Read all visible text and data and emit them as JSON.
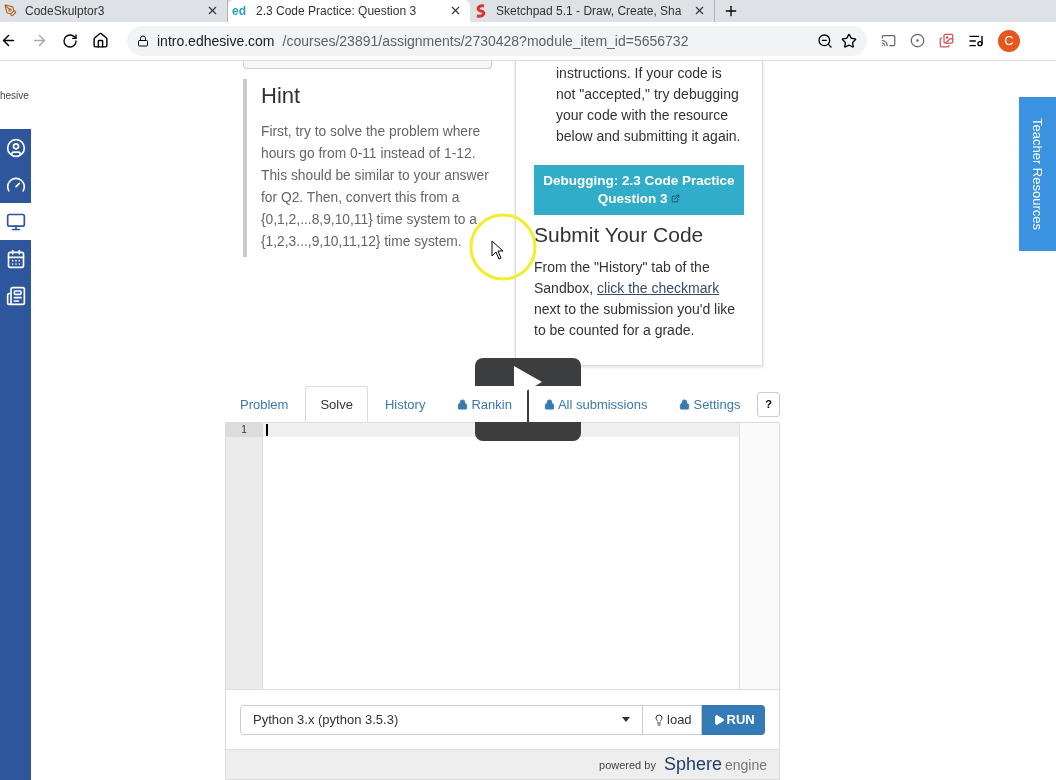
{
  "browser": {
    "tabs": [
      {
        "title": "CodeSkulptor3",
        "selected": false,
        "kind": "pen"
      },
      {
        "title": "2.3 Code Practice: Question 3",
        "selected": true,
        "kind": "letters",
        "favicon_text": "ed"
      },
      {
        "title": "Sketchpad 5.1 - Draw, Create, Sha",
        "selected": false,
        "kind": "swirl"
      }
    ],
    "address": {
      "host": "intro.edhesive.com",
      "path": "/courses/23891/assignments/2730428?module_item_id=5656732"
    },
    "profile_initial": "C"
  },
  "sidebar": {
    "logo_text": "hesive",
    "items": [
      {
        "kind": "avatar",
        "selected": false
      },
      {
        "kind": "gauge",
        "selected": false
      },
      {
        "kind": "monitor",
        "selected": true
      },
      {
        "kind": "calendar",
        "selected": false
      },
      {
        "kind": "document",
        "selected": false
      }
    ]
  },
  "hint": {
    "title": "Hint",
    "text": "First, try to solve the problem where hours go from 0-11 instead of 1-12. This should be similar to your answer for Q2. Then, convert this from a {0,1,2,...8,9,10,11} time system to a {1,2,3...,9,10,11,12} time system."
  },
  "instructions_card": {
    "text": "instructions. If your code is not \"accepted,\" try debugging your code with the resource below and submitting it again.",
    "debug_button": "Debugging: 2.3 Code Practice Question 3",
    "submit_heading": "Submit Your Code",
    "submit_text_before": "From the \"History\" tab of the Sandbox, ",
    "submit_link": "click the checkmark",
    "submit_text_after": " next to the submission you'd like to be counted for a grade."
  },
  "teacher_tab": "Teacher Resources",
  "code_tabs": [
    {
      "label": "Problem",
      "selected": false,
      "locked": false
    },
    {
      "label": "Solve",
      "selected": true,
      "locked": false
    },
    {
      "label": "History",
      "selected": false,
      "locked": false
    },
    {
      "label": "Rankin",
      "selected": false,
      "locked": true
    },
    {
      "label": "All submissions",
      "selected": false,
      "locked": true
    },
    {
      "label": "Settings",
      "selected": false,
      "locked": true
    }
  ],
  "help_button": "?",
  "editor": {
    "line_numbers": [
      "1"
    ]
  },
  "language": "Python 3.x (python 3.5.3)",
  "load_button": "load",
  "run_button": "RUN",
  "powered_by": "powered by",
  "engine_logo": {
    "name": "Sphere",
    "suffix": "engine"
  }
}
